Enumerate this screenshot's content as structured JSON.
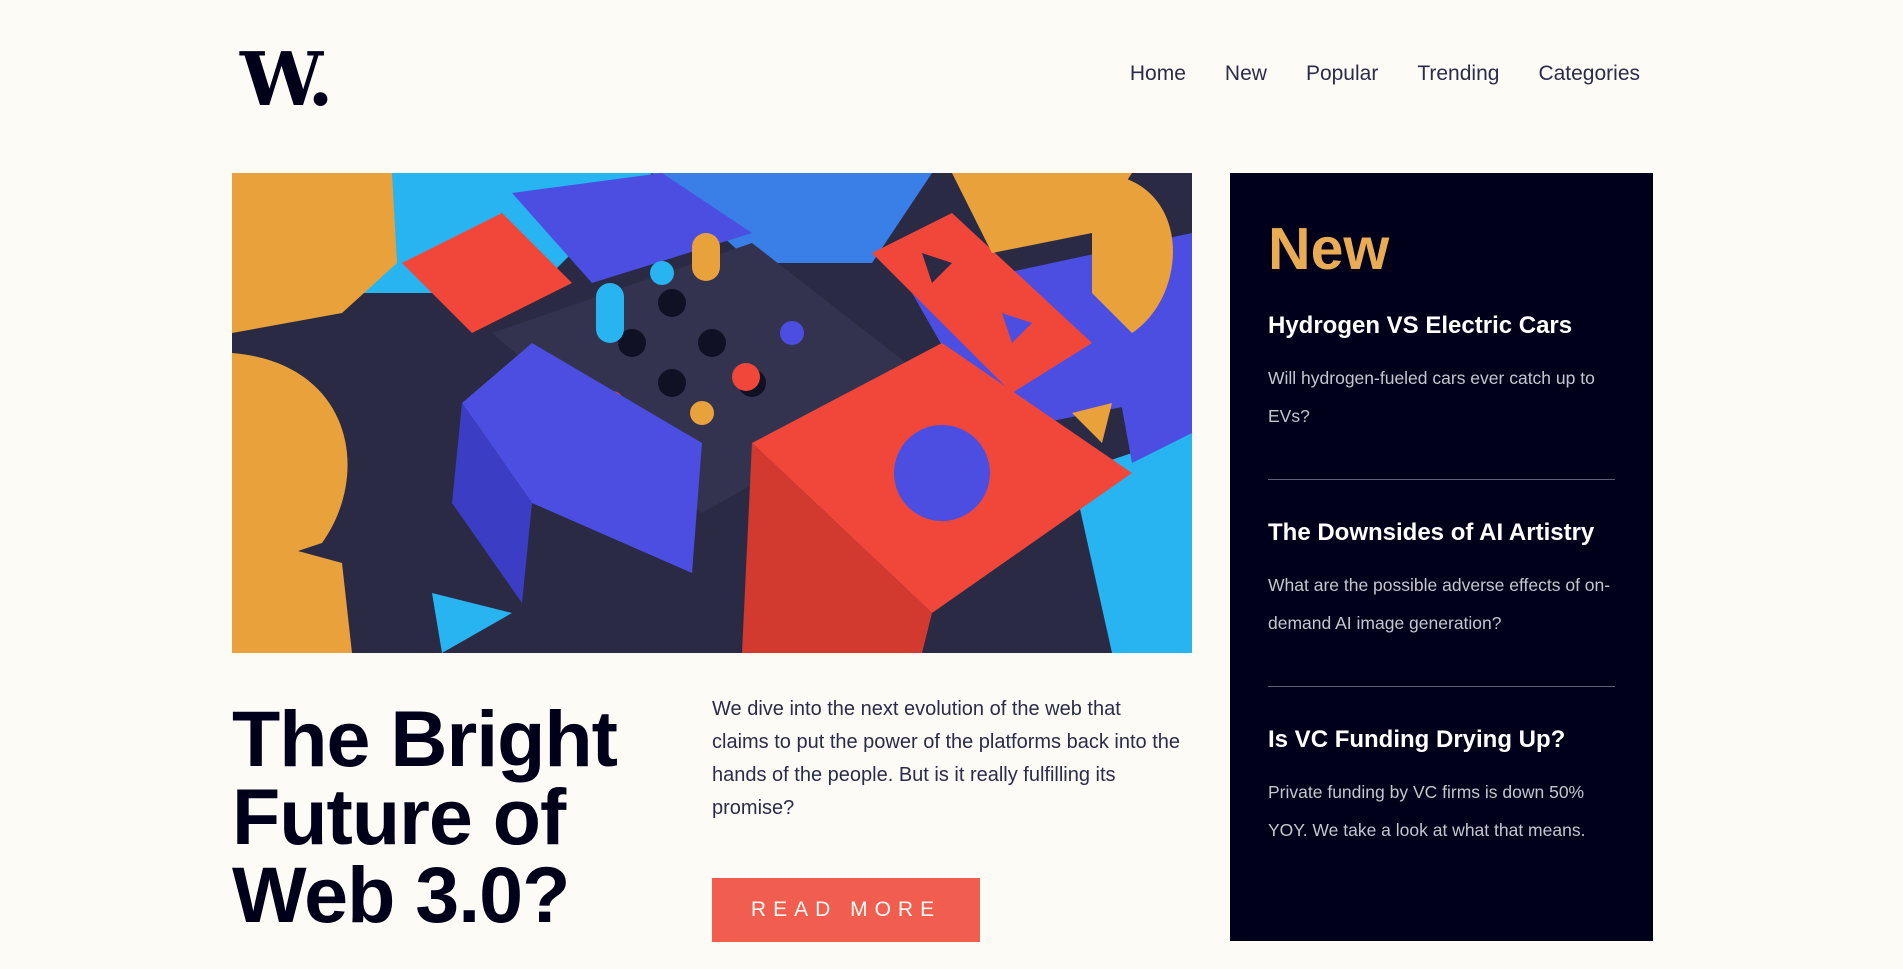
{
  "header": {
    "logo": "W.",
    "nav": [
      "Home",
      "New",
      "Popular",
      "Trending",
      "Categories"
    ]
  },
  "hero": {
    "image_alt": "Colorful 3D geometric blocks",
    "colors": {
      "orange": "#e9a23b",
      "blue": "#4b4ee0",
      "red": "#f0473a",
      "cyan": "#28b4f0",
      "dark": "#2a2a45"
    }
  },
  "article": {
    "headline": "The Bright Future of Web 3.0?",
    "lede": "We dive into the next evolution of the web that claims to put the power of the platforms back into the hands of the people. But is it really fulfilling its promise?",
    "cta": "Read More"
  },
  "sidebar": {
    "title": "New",
    "items": [
      {
        "title": "Hydrogen VS Electric Cars",
        "description": "Will hydrogen-fueled cars ever catch up to EVs?"
      },
      {
        "title": "The Downsides of AI Artistry",
        "description": "What are the possible adverse effects of on-demand AI image generation?"
      },
      {
        "title": "Is VC Funding Drying Up?",
        "description": "Private funding by VC firms is down 50% YOY. We take a look at what that means."
      }
    ]
  },
  "theme": {
    "background": "#fdfbf6",
    "dark": "#00001a",
    "accent_red": "#f15e50",
    "accent_orange": "#e9ab53"
  }
}
